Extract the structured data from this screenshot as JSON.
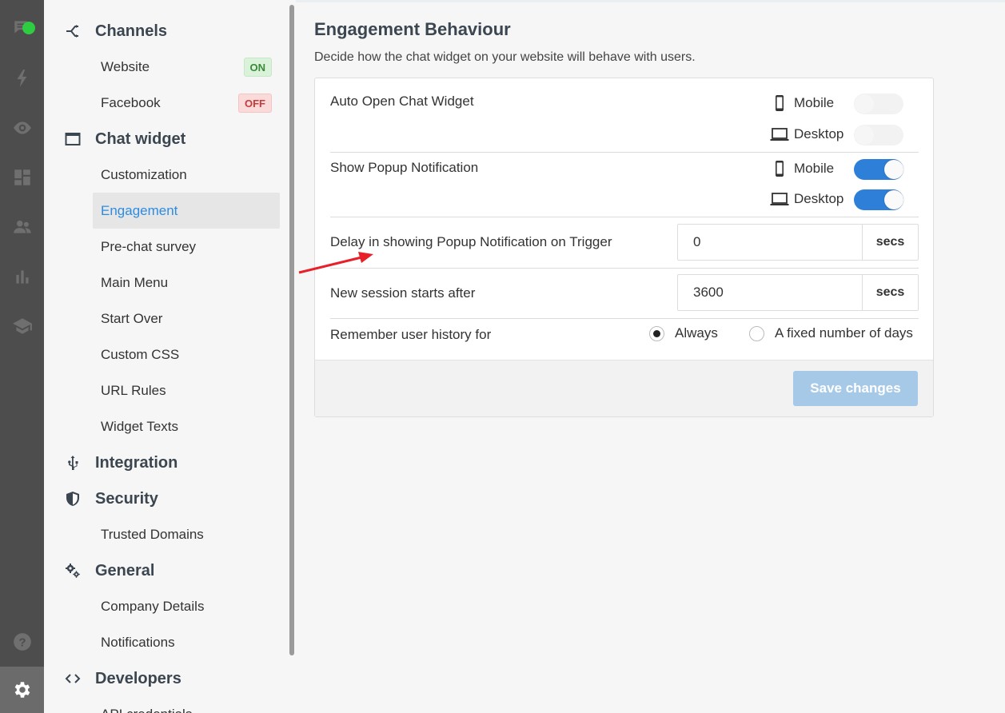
{
  "sidebar": {
    "sections": [
      {
        "title": "Channels",
        "icon": "share-icon"
      },
      {
        "title": "Chat widget",
        "icon": "window-icon"
      },
      {
        "title": "Integration",
        "icon": "usb-icon"
      },
      {
        "title": "Security",
        "icon": "shield-icon"
      },
      {
        "title": "General",
        "icon": "gears-icon"
      },
      {
        "title": "Developers",
        "icon": "code-icon"
      }
    ],
    "channels": [
      {
        "label": "Website",
        "badge": "ON"
      },
      {
        "label": "Facebook",
        "badge": "OFF"
      }
    ],
    "chat_widget_items": [
      "Customization",
      "Engagement",
      "Pre-chat survey",
      "Main Menu",
      "Start Over",
      "Custom CSS",
      "URL Rules",
      "Widget Texts"
    ],
    "security_items": [
      "Trusted Domains"
    ],
    "general_items": [
      "Company Details",
      "Notifications"
    ],
    "developers_items": [
      "API credentials"
    ],
    "active_item": "Engagement"
  },
  "rail": {
    "icons": [
      "chat-icon",
      "lightning-icon",
      "eye-icon",
      "dashboard-icon",
      "users-icon",
      "bar-chart-icon",
      "graduation-cap-icon",
      "help-icon",
      "settings-icon"
    ],
    "active": "settings-icon"
  },
  "main": {
    "title": "Engagement Behaviour",
    "subtitle": "Decide how the chat widget on your website will behave with users.",
    "auto_open": {
      "label": "Auto Open Chat Widget",
      "mobile_label": "Mobile",
      "desktop_label": "Desktop",
      "mobile_on": false,
      "desktop_on": false
    },
    "popup": {
      "label": "Show Popup Notification",
      "mobile_label": "Mobile",
      "desktop_label": "Desktop",
      "mobile_on": true,
      "desktop_on": true
    },
    "delay": {
      "label": "Delay in showing Popup Notification on Trigger",
      "value": "0",
      "unit": "secs"
    },
    "session": {
      "label": "New session starts after",
      "value": "3600",
      "unit": "secs"
    },
    "history": {
      "label": "Remember user history for",
      "options": [
        "Always",
        "A fixed number of days"
      ],
      "selected": "Always"
    },
    "save_label": "Save changes"
  },
  "colors": {
    "accent": "#2d7fd8",
    "rail_bg": "#4d4d4d",
    "annotation_arrow": "#e8202a"
  }
}
